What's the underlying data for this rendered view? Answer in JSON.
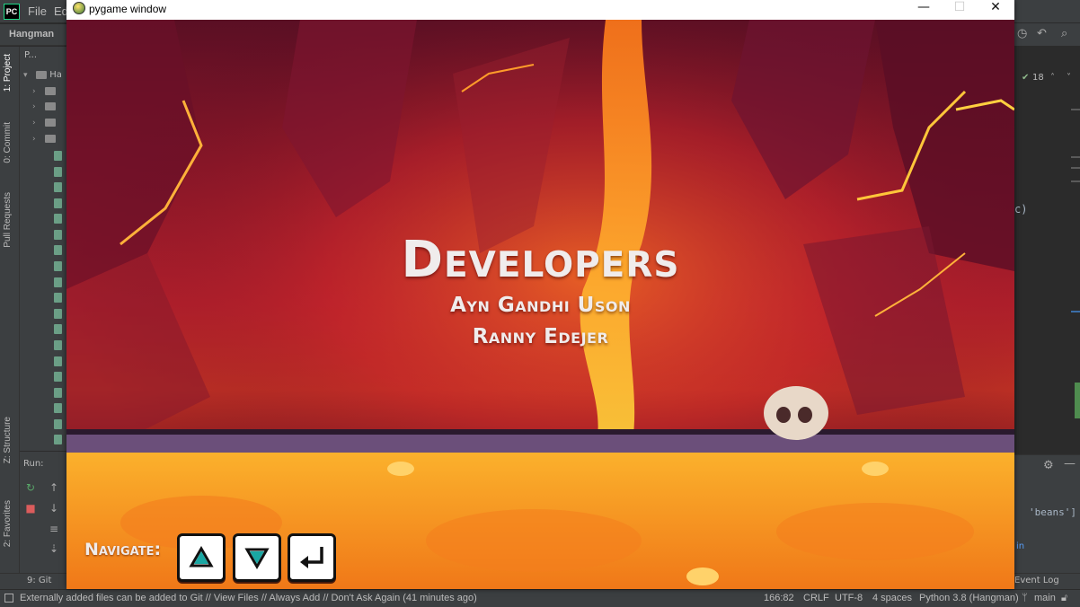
{
  "ide": {
    "menu": [
      "File",
      "Ed"
    ],
    "breadcrumb": "Hangman",
    "project_header": "P...",
    "tree_root": "Ha",
    "side_tabs": [
      "1: Project",
      "0: Commit",
      "Pull Requests",
      "Z: Structure",
      "2: Favorites"
    ],
    "run_label": "Run:",
    "git_tab": "9: Git",
    "right_counter": "18",
    "event_log": "Event Log",
    "editor_fragment_1": "c)",
    "editor_fragment_2": "'beans']",
    "editor_fragment_3": "in",
    "status_message": "Externally added files can be added to Git // View Files // Always Add // Don't Ask Again (41 minutes ago)",
    "cursor_position": "166:82",
    "line_separator": "CRLF",
    "encoding": "UTF-8",
    "indent": "4 spaces",
    "interpreter": "Python 3.8 (Hangman)",
    "branch": "main"
  },
  "pygame": {
    "window_title": "pygame window",
    "credits_title": "Developers",
    "developers": [
      "Ayn Gandhi Uson",
      "Ranny Edejer"
    ],
    "navigate_label": "Navigate:",
    "keys": [
      "up-arrow-icon",
      "down-arrow-icon",
      "enter-icon"
    ]
  },
  "colors": {
    "lava": "#f39a1a",
    "key_arrow": "#19a7a3",
    "text": "#f0ecec"
  }
}
